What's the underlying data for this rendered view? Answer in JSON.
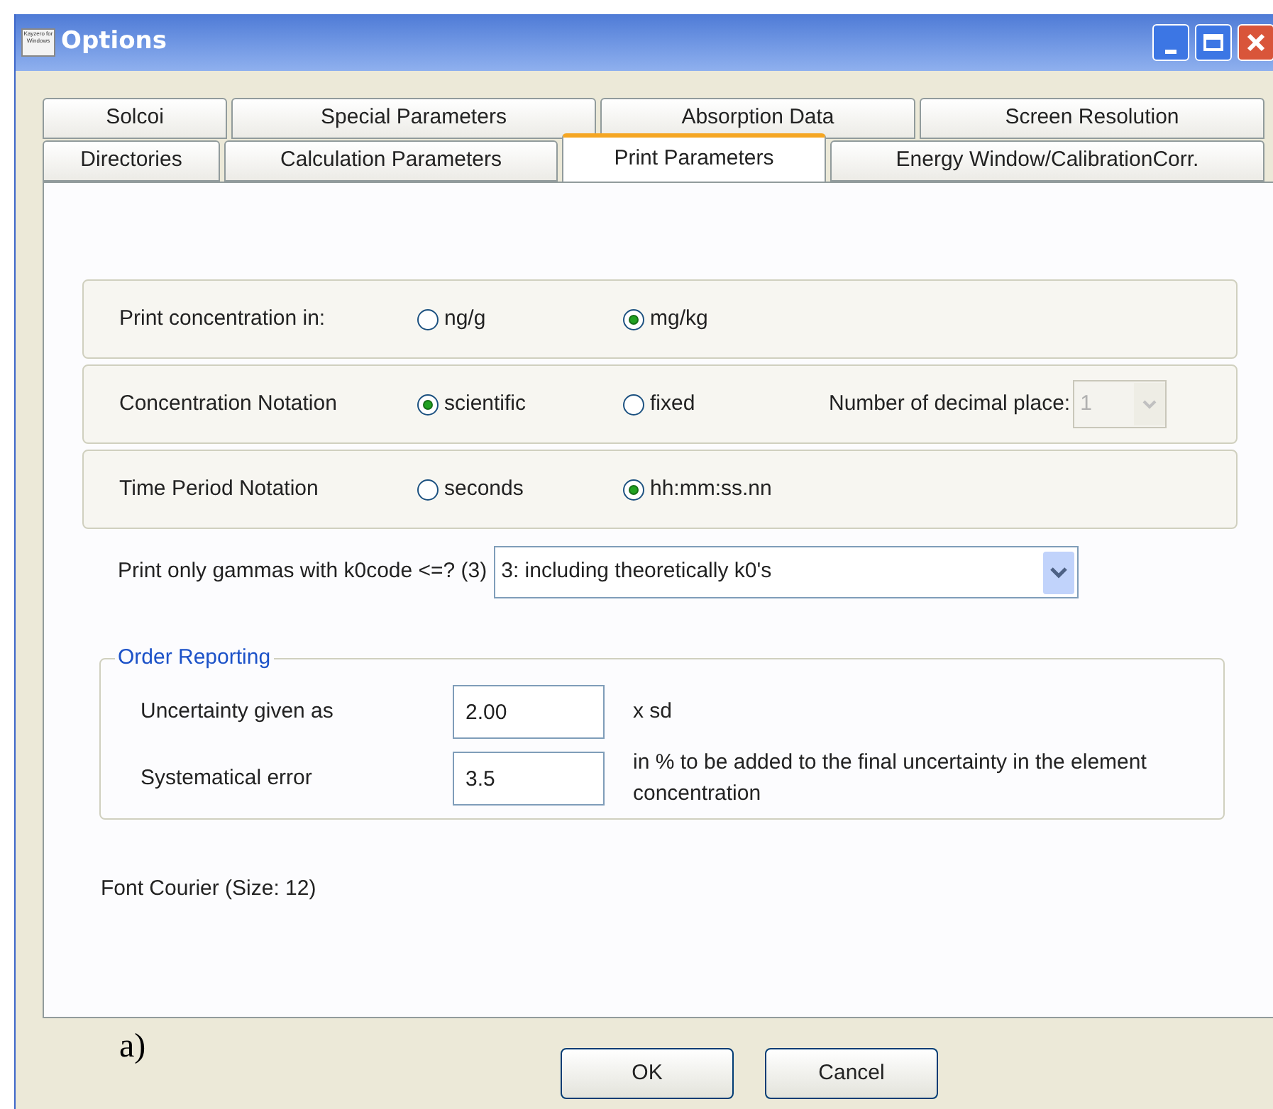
{
  "window": {
    "title": "Options",
    "app_icon_text": "Kayzero for Windows"
  },
  "tab_rows": [
    [
      {
        "label": "Solcoi",
        "selected": false
      },
      {
        "label": "Special Parameters",
        "selected": false
      },
      {
        "label": "Absorption Data",
        "selected": false
      },
      {
        "label": "Screen Resolution",
        "selected": false
      }
    ],
    [
      {
        "label": "Directories",
        "selected": false
      },
      {
        "label": "Calculation Parameters",
        "selected": false
      },
      {
        "label": "Print Parameters",
        "selected": true
      },
      {
        "label": "Energy Window/CalibrationCorr.",
        "selected": false
      }
    ]
  ],
  "option_groups": [
    {
      "label": "Print concentration in:",
      "options": [
        {
          "label": "ng/g",
          "selected": false
        },
        {
          "label": "mg/kg",
          "selected": true
        }
      ]
    },
    {
      "label": "Concentration Notation",
      "options": [
        {
          "label": "scientific",
          "selected": true
        },
        {
          "label": "fixed",
          "selected": false
        }
      ],
      "extra": {
        "label": "Number of decimal place:",
        "value": "1",
        "disabled": true
      }
    },
    {
      "label": "Time Period Notation",
      "options": [
        {
          "label": "seconds",
          "selected": false
        },
        {
          "label": "hh:mm:ss.nn",
          "selected": true
        }
      ]
    }
  ],
  "gamma_filter": {
    "label": "Print only gammas with k0code <=? (3)",
    "value": "3: including theoretically k0's"
  },
  "order_reporting": {
    "title": "Order Reporting",
    "rows": [
      {
        "label": "Uncertainty given as",
        "value": "2.00",
        "note": "x sd"
      },
      {
        "label": "Systematical error",
        "value": "3.5",
        "note": "in % to be added to the final uncertainty in the element concentration"
      }
    ]
  },
  "font_label": "Font Courier (Size: 12)",
  "caption": "a)",
  "buttons": [
    "OK",
    "Cancel"
  ]
}
